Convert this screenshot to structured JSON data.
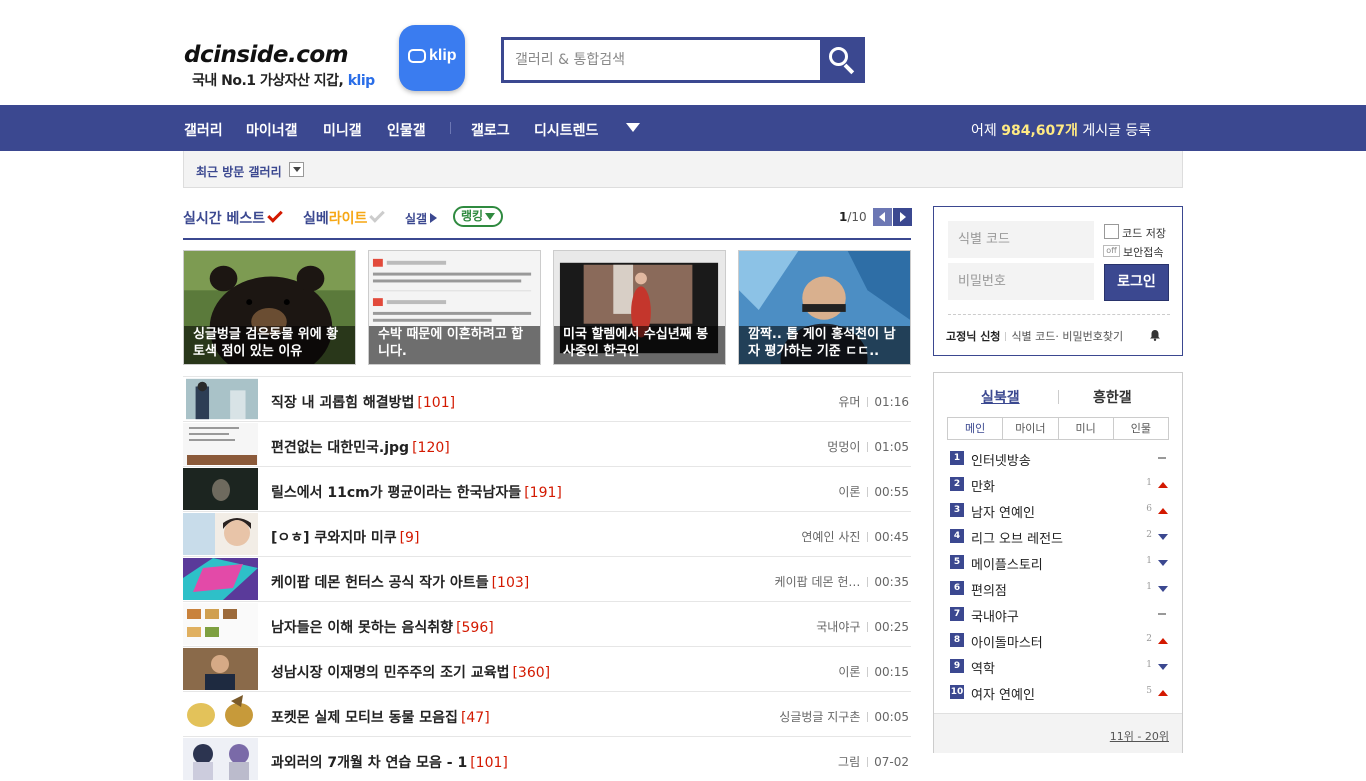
{
  "header": {
    "logo_text": "dcinside.com",
    "logo_sub": "국내 No.1 가상자산 지갑,",
    "logo_sub_brand": "klip",
    "klip_badge_label": "klip",
    "search_placeholder": "갤러리 & 통합검색"
  },
  "nav": {
    "items": [
      "갤러리",
      "마이너갤",
      "미니갤",
      "인물갤",
      "갤로그",
      "디시트렌드"
    ],
    "count_prefix": "어제 ",
    "count_value": "984,607개",
    "count_suffix": " 게시글 등록"
  },
  "recent": {
    "label": "최근 방문 갤러리"
  },
  "tabs": {
    "live_best": "실시간 베스트",
    "silbe_a": "실베",
    "silbe_b": "라이트",
    "silgal": "실갤",
    "ranking": "랭킹",
    "page_current": "1",
    "page_total": "/10"
  },
  "cards": [
    {
      "caption": "싱글벙글 검은동물 위에 황토색 점이 있는 이유"
    },
    {
      "caption": "수박 때문에 이혼하려고 합니다."
    },
    {
      "caption": "미국 할렘에서 수십년째 봉사중인 한국인"
    },
    {
      "caption": "깜짝.. 톱 게이 홍석천이 남자 평가하는 기준 ㄷㄷ.."
    }
  ],
  "posts": [
    {
      "title": "직장 내 괴롭힘 해결방법",
      "replies": "[101]",
      "gallery": "유머",
      "time": "01:16"
    },
    {
      "title": "편견없는 대한민국.jpg",
      "replies": "[120]",
      "gallery": "멍멍이",
      "time": "01:05"
    },
    {
      "title": "릴스에서 11cm가 평균이라는 한국남자들",
      "replies": "[191]",
      "gallery": "이론",
      "time": "00:55"
    },
    {
      "title": "[ㅇㅎ] 쿠와지마 미쿠",
      "replies": "[9]",
      "gallery": "연예인 사진",
      "time": "00:45"
    },
    {
      "title": "케이팝 데몬 헌터스 공식 작가 아트들",
      "replies": "[103]",
      "gallery": "케이팝 데몬 헌…",
      "time": "00:35"
    },
    {
      "title": "남자들은 이해 못하는 음식취향",
      "replies": "[596]",
      "gallery": "국내야구",
      "time": "00:25"
    },
    {
      "title": "성남시장 이재명의 민주주의 조기 교육법",
      "replies": "[360]",
      "gallery": "이론",
      "time": "00:15"
    },
    {
      "title": "포켓몬 실제 모티브 동물 모음집",
      "replies": "[47]",
      "gallery": "싱글벙글 지구촌",
      "time": "00:05"
    },
    {
      "title": "과외러의 7개월 차 연습 모음 - 1",
      "replies": "[101]",
      "gallery": "그림",
      "time": "07-02"
    }
  ],
  "login": {
    "id_placeholder": "식별 코드",
    "pw_placeholder": "비밀번호",
    "save_code": "코드 저장",
    "off_badge": "off",
    "secure": "보안접속",
    "login_button": "로그인",
    "fixed_nick": "고정닉 신청",
    "find_links": "식별 코드· 비밀번호찾기"
  },
  "ranking": {
    "tab_active": "실북갤",
    "tab_other": "흥한갤",
    "categories": [
      "메인",
      "마이너",
      "미니",
      "인물"
    ],
    "items": [
      {
        "no": "1",
        "name": "인터넷방송",
        "change": "",
        "dir": "same"
      },
      {
        "no": "2",
        "name": "만화",
        "change": "1",
        "dir": "up"
      },
      {
        "no": "3",
        "name": "남자 연예인",
        "change": "6",
        "dir": "up"
      },
      {
        "no": "4",
        "name": "리그 오브 레전드",
        "change": "2",
        "dir": "down"
      },
      {
        "no": "5",
        "name": "메이플스토리",
        "change": "1",
        "dir": "down"
      },
      {
        "no": "6",
        "name": "편의점",
        "change": "1",
        "dir": "down"
      },
      {
        "no": "7",
        "name": "국내야구",
        "change": "",
        "dir": "same"
      },
      {
        "no": "8",
        "name": "아이돌마스터",
        "change": "2",
        "dir": "up"
      },
      {
        "no": "9",
        "name": "역학",
        "change": "1",
        "dir": "down"
      },
      {
        "no": "10",
        "name": "여자 연예인",
        "change": "5",
        "dir": "up"
      }
    ],
    "more_link": "11위 - 20위"
  },
  "colors": {
    "brand": "#3b4890",
    "reply": "#d31900",
    "highlight": "#ffea83",
    "rank_green": "#2f8a3f"
  }
}
